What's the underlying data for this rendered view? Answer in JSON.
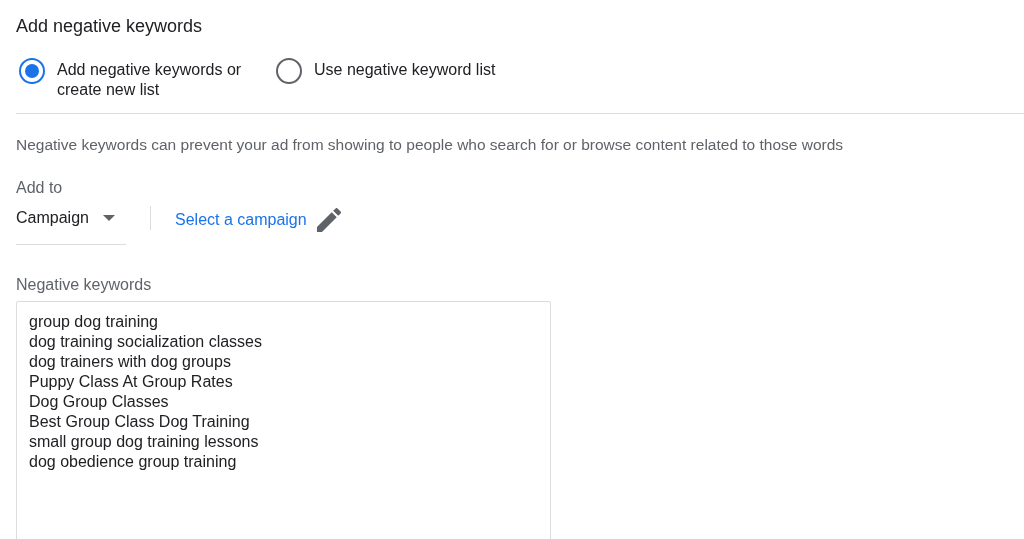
{
  "title": "Add negative keywords",
  "options": [
    {
      "label": "Add negative keywords or create new list",
      "selected": true
    },
    {
      "label": "Use negative keyword list",
      "selected": false
    }
  ],
  "description": "Negative keywords can prevent your ad from showing to people who search for or browse content related to those words",
  "add_to": {
    "label": "Add to",
    "value": "Campaign",
    "link": "Select a campaign"
  },
  "keywords_field": {
    "label": "Negative keywords",
    "lines": [
      "group dog training",
      "dog training socialization classes",
      "dog trainers with dog groups",
      "Puppy Class At Group Rates",
      "Dog Group Classes",
      "Best Group Class Dog Training",
      "small group dog training lessons",
      "dog obedience group training"
    ]
  }
}
